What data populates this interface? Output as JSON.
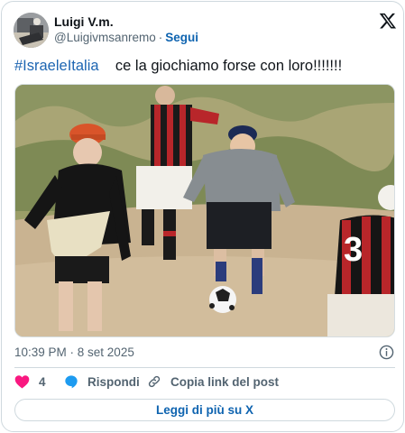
{
  "user": {
    "display_name": "Luigi V.m.",
    "handle": "@Luigivmsanremo",
    "separator": "·",
    "follow_label": "Segui"
  },
  "tweet": {
    "hashtag": "#IsraeleItalia",
    "text": "    ce la giochiamo forse con loro!!!!!!!",
    "timestamp": "10:39 PM · 8 set 2025"
  },
  "media": {
    "description_icon": "video-still",
    "jersey_number": "3"
  },
  "actions": {
    "like_count": "4",
    "reply_label": "Rispondi",
    "copy_link_label": "Copia link del post"
  },
  "footer": {
    "read_more_label": "Leggi di più su X"
  },
  "colors": {
    "link": "#1d65b2",
    "like": "#f91880",
    "reply": "#1d9bf0",
    "border": "#cfd9de"
  }
}
